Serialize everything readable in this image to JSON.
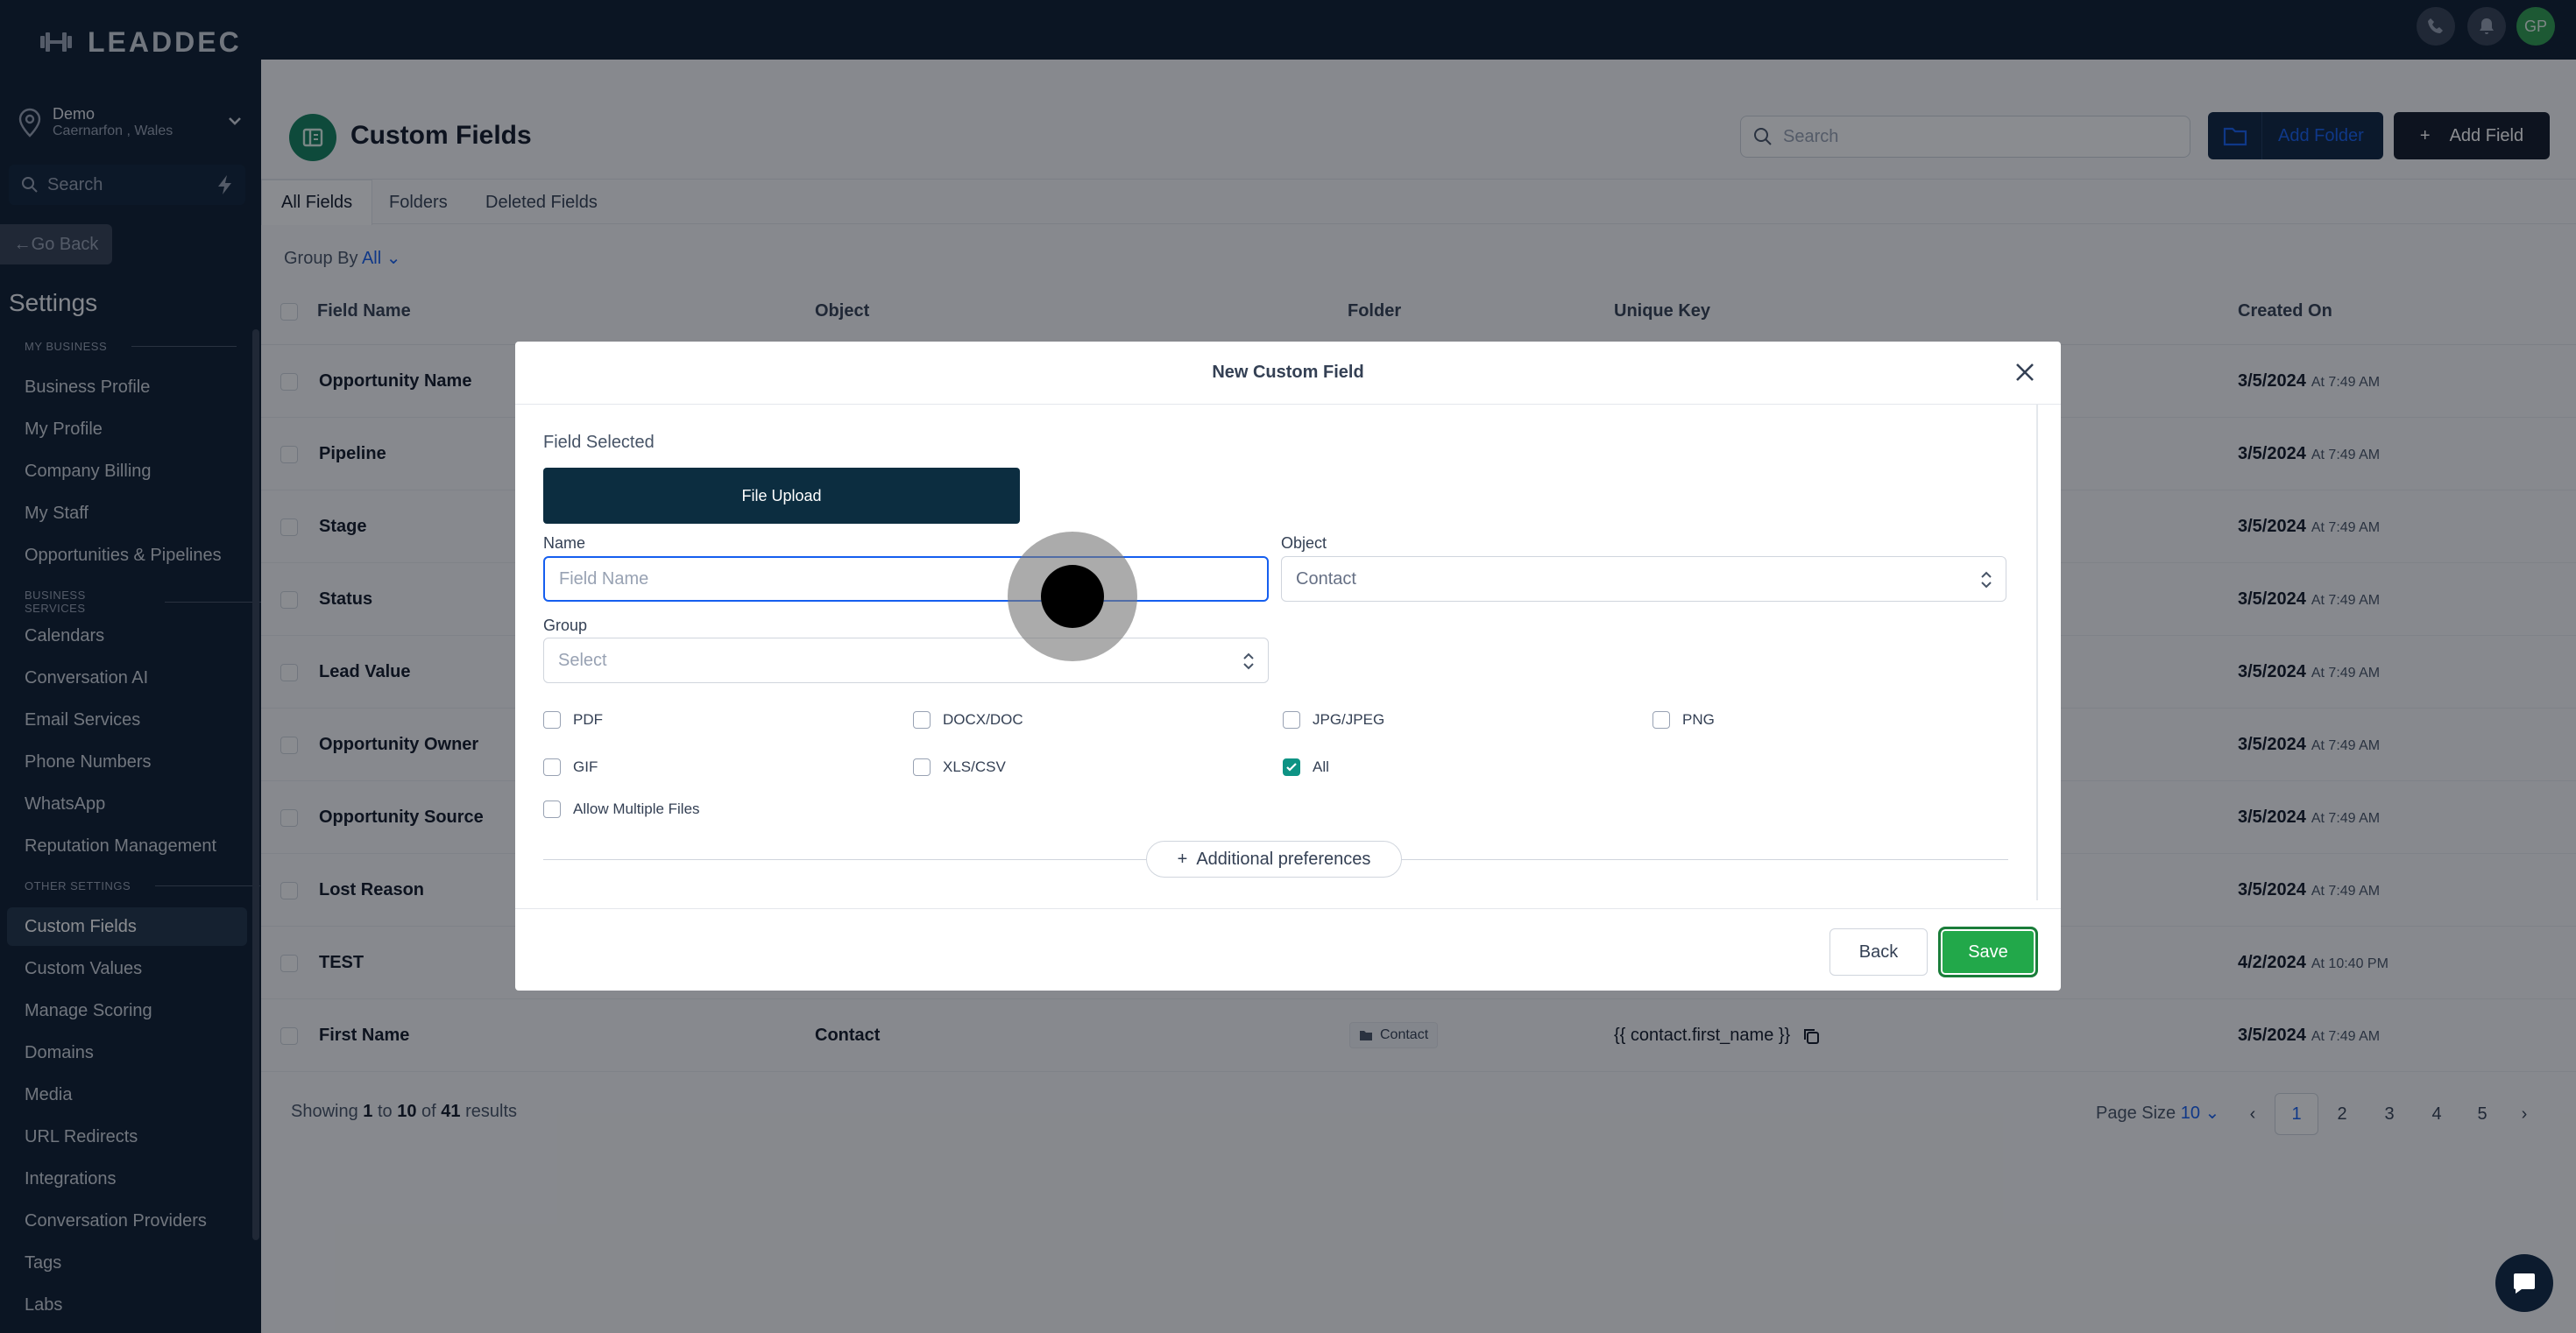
{
  "brand": {
    "logo_text": "LEADDEC"
  },
  "location": {
    "name": "Demo",
    "address": "Caernarfon , Wales"
  },
  "sidebar": {
    "search_placeholder": "Search",
    "go_back": "Go Back",
    "settings_title": "Settings",
    "sections": [
      {
        "label": "MY BUSINESS",
        "items": [
          "Business Profile",
          "My Profile",
          "Company Billing",
          "My Staff",
          "Opportunities & Pipelines"
        ]
      },
      {
        "label": "BUSINESS SERVICES",
        "items": [
          "Calendars",
          "Conversation AI",
          "Email Services",
          "Phone Numbers",
          "WhatsApp",
          "Reputation Management"
        ]
      },
      {
        "label": "OTHER SETTINGS",
        "items": [
          "Custom Fields",
          "Custom Values",
          "Manage Scoring",
          "Domains",
          "Media",
          "URL Redirects",
          "Integrations",
          "Conversation Providers",
          "Tags",
          "Labs"
        ]
      }
    ],
    "active_item": "Custom Fields"
  },
  "topbar": {
    "avatar_initials": "GP"
  },
  "page": {
    "title": "Custom Fields",
    "search_placeholder": "Search",
    "add_folder_label": "Add Folder",
    "add_field_label": "Add Field",
    "tabs": [
      "All Fields",
      "Folders",
      "Deleted Fields"
    ],
    "group_by_label": "Group By",
    "group_by_value": "All"
  },
  "table": {
    "headers": [
      "Field Name",
      "Object",
      "Folder",
      "Unique Key",
      "Created On"
    ],
    "rows": [
      {
        "name": "Opportunity Name",
        "object": "",
        "folder": "",
        "key": "",
        "date": "3/5/2024",
        "time": "At 7:49 AM"
      },
      {
        "name": "Pipeline",
        "object": "",
        "folder": "",
        "key": "",
        "date": "3/5/2024",
        "time": "At 7:49 AM"
      },
      {
        "name": "Stage",
        "object": "",
        "folder": "",
        "key": "",
        "date": "3/5/2024",
        "time": "At 7:49 AM"
      },
      {
        "name": "Status",
        "object": "",
        "folder": "",
        "key": "",
        "date": "3/5/2024",
        "time": "At 7:49 AM"
      },
      {
        "name": "Lead Value",
        "object": "",
        "folder": "",
        "key": "",
        "date": "3/5/2024",
        "time": "At 7:49 AM"
      },
      {
        "name": "Opportunity Owner",
        "object": "",
        "folder": "",
        "key": "",
        "date": "3/5/2024",
        "time": "At 7:49 AM"
      },
      {
        "name": "Opportunity Source",
        "object": "",
        "folder": "",
        "key": "",
        "date": "3/5/2024",
        "time": "At 7:49 AM"
      },
      {
        "name": "Lost Reason",
        "object": "",
        "folder": "",
        "key": "",
        "date": "3/5/2024",
        "time": "At 7:49 AM"
      },
      {
        "name": "TEST",
        "object": "",
        "folder": "",
        "key": "",
        "date": "4/2/2024",
        "time": "At 10:40 PM"
      },
      {
        "name": "First Name",
        "object": "Contact",
        "folder": "Contact",
        "key": "{{ contact.first_name }}",
        "date": "3/5/2024",
        "time": "At 7:49 AM"
      }
    ]
  },
  "pagination": {
    "showing_prefix": "Showing",
    "from": "1",
    "to_word": "to",
    "to": "10",
    "of_word": "of",
    "total": "41",
    "results_word": "results",
    "page_size_label": "Page Size",
    "page_size_value": "10",
    "pages": [
      "1",
      "2",
      "3",
      "4",
      "5"
    ],
    "current_page": "1"
  },
  "modal": {
    "title": "New Custom Field",
    "field_selected_label": "Field Selected",
    "field_type": "File Upload",
    "name_label": "Name",
    "name_placeholder": "Field Name",
    "object_label": "Object",
    "object_value": "Contact",
    "group_label": "Group",
    "group_placeholder": "Select",
    "file_types": [
      {
        "label": "PDF",
        "checked": false
      },
      {
        "label": "DOCX/DOC",
        "checked": false
      },
      {
        "label": "JPG/JPEG",
        "checked": false
      },
      {
        "label": "PNG",
        "checked": false
      },
      {
        "label": "GIF",
        "checked": false
      },
      {
        "label": "XLS/CSV",
        "checked": false
      },
      {
        "label": "All",
        "checked": true
      }
    ],
    "allow_multiple_label": "Allow Multiple Files",
    "allow_multiple_checked": false,
    "additional_preferences": "Additional preferences",
    "back_label": "Back",
    "save_label": "Save"
  },
  "colors": {
    "sidebar_bg": "#0c1b2e",
    "primary_blue": "#155eef",
    "save_green": "#22a84a",
    "check_teal": "#0e9384"
  }
}
